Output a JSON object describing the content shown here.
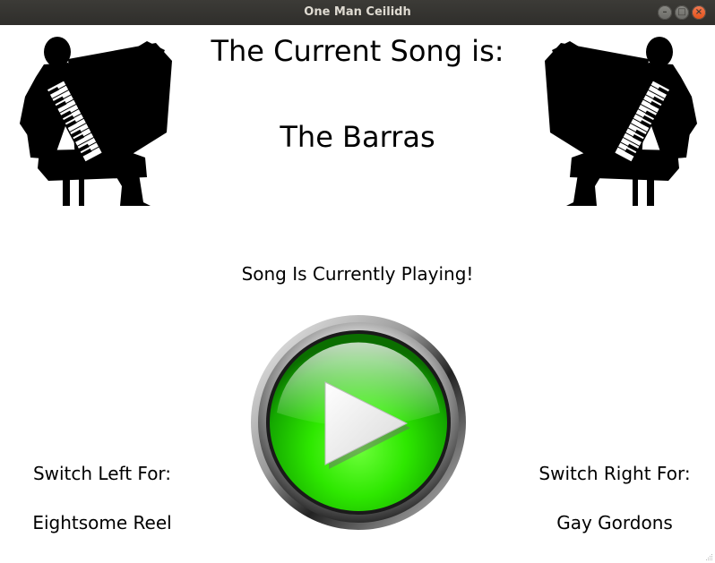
{
  "window": {
    "title": "One Man Ceilidh"
  },
  "header": {
    "current_label": "The Current Song is:",
    "song_name": "The Barras"
  },
  "status": {
    "text": "Song Is Currently Playing!"
  },
  "left": {
    "label": "Switch Left For:",
    "song": "Eightsome Reel"
  },
  "right": {
    "label": "Switch Right For:",
    "song": "Gay Gordons"
  },
  "icons": {
    "play": "play-icon",
    "accordion_player": "accordion-player-icon",
    "close": "close-icon",
    "maximize": "maximize-icon",
    "minimize": "minimize-icon"
  },
  "colors": {
    "titlebar": "#3c3b37",
    "play_green": "#22e000",
    "silhouette": "#000000"
  }
}
